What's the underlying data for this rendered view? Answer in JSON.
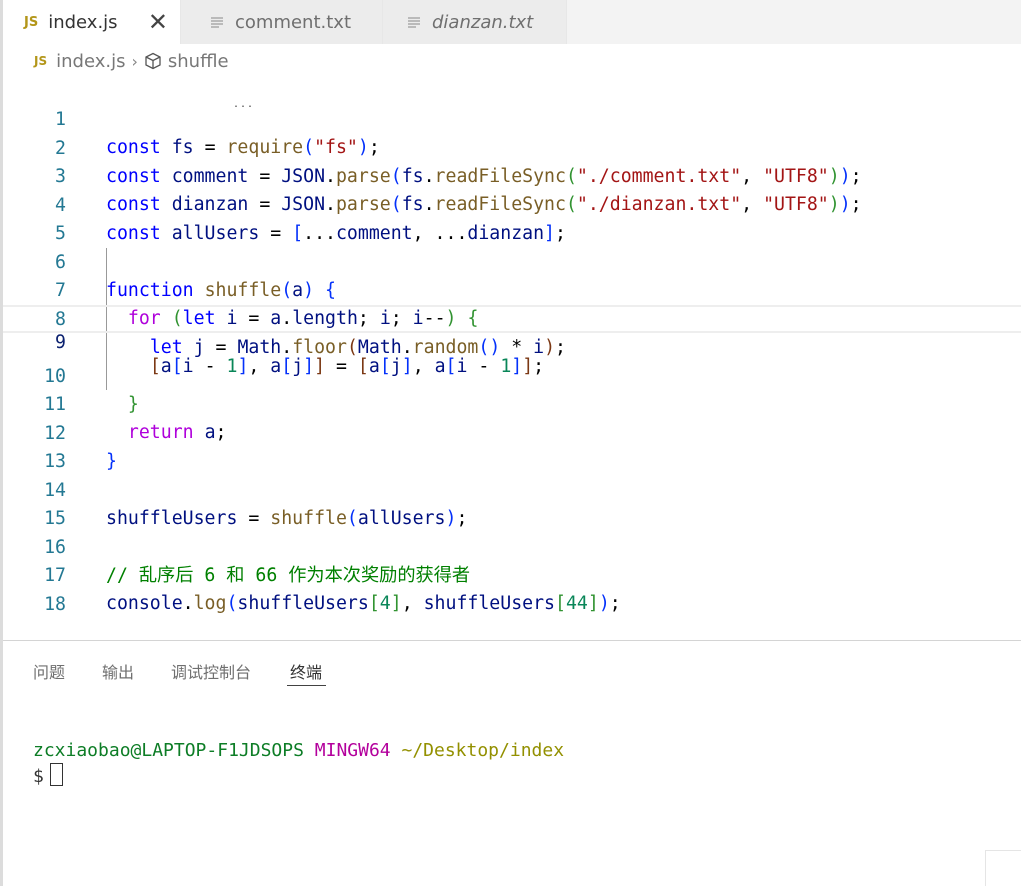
{
  "tabs": [
    {
      "icon": "JS",
      "label": "index.js",
      "close": "✕"
    },
    {
      "icon": "lines-icon",
      "label": "comment.txt"
    },
    {
      "icon": "lines-icon",
      "label": "dianzan.txt"
    }
  ],
  "breadcrumb": {
    "icon": "JS",
    "file": "index.js",
    "separator": "›",
    "symbol": "shuffle"
  },
  "editor": {
    "current_line": 9,
    "lines": [
      {
        "n": "1"
      },
      {
        "n": "2"
      },
      {
        "n": "3"
      },
      {
        "n": "4"
      },
      {
        "n": "5"
      },
      {
        "n": "6"
      },
      {
        "n": "7"
      },
      {
        "n": "8"
      },
      {
        "n": "9"
      },
      {
        "n": "10"
      },
      {
        "n": "11"
      },
      {
        "n": "12"
      },
      {
        "n": "13"
      },
      {
        "n": "14"
      },
      {
        "n": "15"
      },
      {
        "n": "16"
      },
      {
        "n": "17"
      },
      {
        "n": "18"
      }
    ],
    "code": {
      "l1": [
        "const",
        "fs",
        "=",
        "require",
        "(",
        "\"fs\"",
        ");"
      ],
      "l2": [
        "const",
        "comment",
        "=",
        "JSON",
        ".",
        "parse",
        "(",
        "fs",
        ".",
        "readFileSync",
        "(",
        "\"./comment.txt\"",
        ", ",
        "\"UTF8\"",
        "))",
        ";"
      ],
      "l3": [
        "const",
        "dianzan",
        "=",
        "JSON",
        ".",
        "parse",
        "(",
        "fs",
        ".",
        "readFileSync",
        "(",
        "\"./dianzan.txt\"",
        ", ",
        "\"UTF8\"",
        "))",
        ";"
      ],
      "l4": [
        "const",
        "allUsers",
        "=",
        "[",
        "...",
        "comment",
        ", ...",
        "dianzan",
        "]",
        ";"
      ],
      "l6": [
        "function",
        "shuffle",
        "(",
        "a",
        ")",
        "{"
      ],
      "l7": [
        "for",
        "(",
        "let",
        "i",
        "=",
        "a",
        ".",
        "length",
        "; ",
        "i",
        "; ",
        "i",
        "--",
        ")",
        "{"
      ],
      "l8": [
        "let",
        "j",
        "=",
        "Math",
        ".",
        "floor",
        "(",
        "Math",
        ".",
        "random",
        "()",
        " * ",
        "i",
        ")",
        ";"
      ],
      "l9": [
        "[",
        "a",
        "[",
        "i",
        " - ",
        "1",
        "]",
        ", ",
        "a",
        "[",
        "j",
        "]",
        "]",
        " = ",
        "[",
        "a",
        "[",
        "j",
        "]",
        ", ",
        "a",
        "[",
        "i",
        " - ",
        "1",
        "]",
        "]",
        ";"
      ],
      "l10": [
        "}"
      ],
      "l11": [
        "return",
        "a",
        ";"
      ],
      "l12": [
        "}"
      ],
      "l14": [
        "shuffleUsers",
        "=",
        "shuffle",
        "(",
        "allUsers",
        ")",
        ";"
      ],
      "l16": [
        "// 乱序后 6 和 66 作为本次奖励的获得者"
      ],
      "l17": [
        "console",
        ".",
        "log",
        "(",
        "shuffleUsers",
        "[",
        "4",
        "]",
        ", ",
        "shuffleUsers",
        "[",
        "44",
        "]",
        ")",
        ";"
      ]
    },
    "hint_dots": "..."
  },
  "panel": {
    "tabs": [
      "问题",
      "输出",
      "调试控制台",
      "终端"
    ],
    "active_tab": "终端"
  },
  "terminal": {
    "user_host": "zcxiaobao@LAPTOP-F1JDSOPS",
    "shell": "MINGW64",
    "path": "~/Desktop/index",
    "prompt": "$"
  },
  "colors": {
    "keyword": "#0000ff",
    "control": "#af00db",
    "function": "#795e26",
    "variable": "#001080",
    "type": "#267f99",
    "string": "#a31515",
    "number": "#098658",
    "comment": "#008000",
    "line_number": "#237893"
  }
}
